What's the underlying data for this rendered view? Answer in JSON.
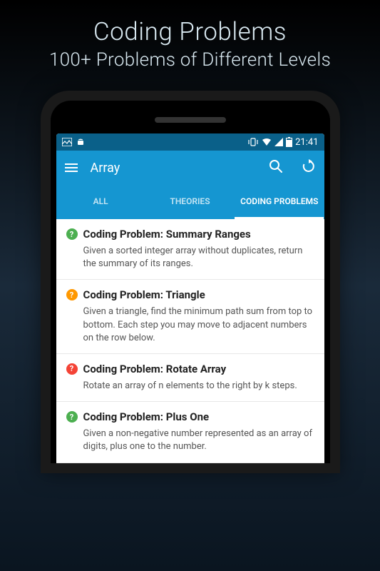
{
  "promo": {
    "title": "Coding Problems",
    "subtitle": "100+ Problems of Different Levels"
  },
  "status_bar": {
    "time": "21:41"
  },
  "app_bar": {
    "title": "Array"
  },
  "tabs": [
    {
      "label": "ALL"
    },
    {
      "label": "THEORIES"
    },
    {
      "label": "CODING PROBLEMS"
    }
  ],
  "problems": [
    {
      "difficulty": "green",
      "title": "Coding Problem: Summary Ranges",
      "description": "Given a sorted integer array without duplicates, return the summary of its ranges."
    },
    {
      "difficulty": "orange",
      "title": "Coding Problem: Triangle",
      "description": "Given a triangle, find the minimum path sum from top to bottom. Each step you may move to adjacent numbers on the row below."
    },
    {
      "difficulty": "red",
      "title": "Coding Problem: Rotate Array",
      "description": "Rotate an array of n elements to the right by k steps."
    },
    {
      "difficulty": "green",
      "title": "Coding Problem: Plus One",
      "description": "Given a non-negative number represented as an array of digits, plus one to the number."
    }
  ]
}
